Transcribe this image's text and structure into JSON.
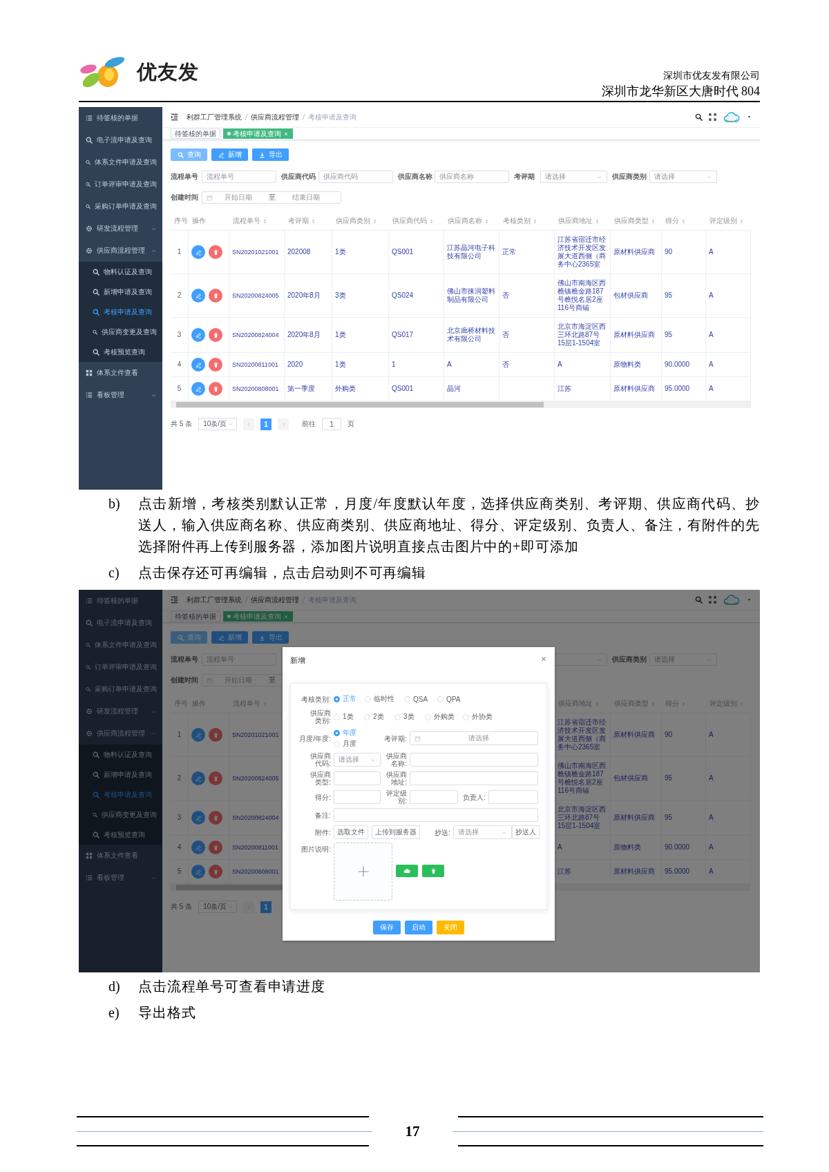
{
  "header": {
    "logo_text": "优友发",
    "company": "深圳市优友发有限公司",
    "address": "深圳市龙华新区大唐时代 804"
  },
  "content": [
    {
      "kind": "screenshot",
      "sidebar": [
        {
          "label": "待签核的单据",
          "selected": false
        },
        {
          "label": "电子流申请及查询",
          "selected": false
        },
        {
          "label": "体系文件申请及查询",
          "selected": false
        },
        {
          "label": "订单评审申请及查询",
          "selected": false
        },
        {
          "label": "采购订单申请及查询",
          "selected": false
        },
        {
          "label": "研发流程管理",
          "selected": false,
          "expanded": false
        },
        {
          "label": "供应商流程管理",
          "selected": false,
          "expanded": true,
          "children": [
            {
              "label": "物料认证及查询",
              "selected": false
            },
            {
              "label": "新增申请及查询",
              "selected": false
            },
            {
              "label": "考核申请及查询",
              "selected": true
            },
            {
              "label": "供应商变更及查询",
              "selected": false
            },
            {
              "label": "考核预览查询",
              "selected": false
            }
          ]
        },
        {
          "label": "体系文件查看",
          "selected": false
        },
        {
          "label": "看板管理",
          "selected": false,
          "expanded": false
        }
      ],
      "breadcrumb": [
        {
          "label": "利群工厂管理系统",
          "current": false
        },
        {
          "label": "供应商流程管理",
          "current": false
        },
        {
          "label": "考核申请及查询",
          "current": true
        }
      ],
      "tags": [
        {
          "label": "待签核的单据",
          "selected": false
        },
        {
          "label": "考核申请及查询",
          "selected": true
        }
      ],
      "toolbar": [
        {
          "label": "查询",
          "kind": "plain"
        },
        {
          "label": "新增",
          "kind": "primary"
        },
        {
          "label": "导出",
          "kind": "primary"
        }
      ],
      "filters": {
        "flow_no": {
          "kind": "input",
          "label": "流程单号",
          "placeholder": "流程单号"
        },
        "supplier_code": {
          "kind": "input",
          "label": "供应商代码",
          "placeholder": "供应商代码"
        },
        "supplier_name": {
          "kind": "input",
          "label": "供应商名称",
          "placeholder": "供应商名称"
        },
        "period": {
          "kind": "select",
          "label": "考评期",
          "placeholder": "请选择"
        },
        "supplier_category": {
          "kind": "select",
          "label": "供应商类别",
          "placeholder": "请选择"
        },
        "created": {
          "kind": "date_range",
          "label": "创建时间",
          "start_placeholder": "开始日期",
          "separator": "至",
          "end_placeholder": "结束日期"
        }
      },
      "table": {
        "columns": {
          "seq": {
            "label": "序号",
            "sortable": false
          },
          "op": {
            "label": "操作",
            "sortable": false
          },
          "flow_no": {
            "label": "流程单号",
            "sortable": true
          },
          "period": {
            "label": "考评期",
            "sortable": true
          },
          "supplier_category": {
            "label": "供应商类别",
            "sortable": true
          },
          "supplier_code": {
            "label": "供应商代码",
            "sortable": true
          },
          "supplier_name": {
            "label": "供应商名称",
            "sortable": true
          },
          "assess_type": {
            "label": "考核类别",
            "sortable": true
          },
          "supplier_address": {
            "label": "供应商地址",
            "sortable": true
          },
          "supplier_type": {
            "label": "供应商类型",
            "sortable": true
          },
          "score": {
            "label": "得分",
            "sortable": true
          },
          "grade": {
            "label": "评定级别",
            "sortable": true
          }
        },
        "rows": [
          {
            "seq": "1",
            "flow_no": "SN20201021001",
            "period": "202008",
            "supplier_category": "1类",
            "supplier_code": "QS001",
            "supplier_name": "江苏晶河电子科技有限公司",
            "assess_type": "正常",
            "supplier_address": "江苏省宿迁市经济技术开发区发展大道西侧（商务中心2365室",
            "supplier_type": "原材料供应商",
            "score": "90",
            "grade": "A"
          },
          {
            "seq": "2",
            "flow_no": "SN20200824005",
            "period": "2020年8月",
            "supplier_category": "3类",
            "supplier_code": "QS024",
            "supplier_name": "佛山市徕润塑料制品有限公司",
            "assess_type": "否",
            "supplier_address": "佛山市南海区西樵镇樵金路187号樵悦名居2座116号商铺",
            "supplier_type": "包材供应商",
            "score": "95",
            "grade": "A"
          },
          {
            "seq": "3",
            "flow_no": "SN20200824004",
            "period": "2020年8月",
            "supplier_category": "1类",
            "supplier_code": "QS017",
            "supplier_name": "北京廊桥材料技术有限公司",
            "assess_type": "否",
            "supplier_address": "北京市海淀区西三环北路87号15层1-1504室",
            "supplier_type": "原材料供应商",
            "score": "95",
            "grade": "A"
          },
          {
            "seq": "4",
            "flow_no": "SN20200811001",
            "period": "2020",
            "supplier_category": "1类",
            "supplier_code": "1",
            "supplier_name": "A",
            "assess_type": "否",
            "supplier_address": "A",
            "supplier_type": "原物料类",
            "score": "90.0000",
            "grade": "A"
          },
          {
            "seq": "5",
            "flow_no": "SN20200808001",
            "period": "第一季度",
            "supplier_category": "外购类",
            "supplier_code": "QS001",
            "supplier_name": "晶河",
            "supplier_address": "江苏",
            "supplier_type": "原材料供应商",
            "score": "95.0000",
            "grade": "A"
          }
        ]
      },
      "pager": {
        "total": "共 5 条",
        "page_size": "10条/页",
        "pages": [
          {
            "label": "1",
            "selected": true
          }
        ],
        "goto_label": "前往",
        "goto_value": "1",
        "page_suffix": "页"
      }
    },
    {
      "kind": "note",
      "marker": "b)",
      "text": "点击新增，考核类别默认正常，月度/年度默认年度，选择供应商类别、考评期、供应商代码、抄送人，输入供应商名称、供应商类别、供应商地址、得分、评定级别、负责人、备注，有附件的先选择附件再上传到服务器，添加图片说明直接点击图片中的+即可添加"
    },
    {
      "kind": "note",
      "marker": "c)",
      "text": "点击保存还可再编辑，点击启动则不可再编辑"
    },
    {
      "kind": "screenshot",
      "sidebar": [
        {
          "label": "待签核的单据",
          "selected": false
        },
        {
          "label": "电子流申请及查询",
          "selected": false
        },
        {
          "label": "体系文件申请及查询",
          "selected": false
        },
        {
          "label": "订单评审申请及查询",
          "selected": false
        },
        {
          "label": "采购订单申请及查询",
          "selected": false
        },
        {
          "label": "研发流程管理",
          "selected": false,
          "expanded": false
        },
        {
          "label": "供应商流程管理",
          "selected": false,
          "expanded": true,
          "children": [
            {
              "label": "物料认证及查询",
              "selected": false
            },
            {
              "label": "新增申请及查询",
              "selected": false
            },
            {
              "label": "考核申请及查询",
              "selected": true
            },
            {
              "label": "供应商变更及查询",
              "selected": false
            },
            {
              "label": "考核预览查询",
              "selected": false
            }
          ]
        },
        {
          "label": "体系文件查看",
          "selected": false
        },
        {
          "label": "看板管理",
          "selected": false,
          "expanded": false
        }
      ],
      "breadcrumb": [
        {
          "label": "利群工厂管理系统",
          "current": false
        },
        {
          "label": "供应商流程管理",
          "current": false
        },
        {
          "label": "考核申请及查询",
          "current": true
        }
      ],
      "tags": [
        {
          "label": "待签核的单据",
          "selected": false
        },
        {
          "label": "考核申请及查询",
          "selected": true
        }
      ],
      "toolbar": [
        {
          "label": "查询",
          "kind": "plain"
        },
        {
          "label": "新增",
          "kind": "primary"
        },
        {
          "label": "导出",
          "kind": "primary"
        }
      ],
      "filters": {
        "flow_no": {
          "kind": "input",
          "label": "流程单号",
          "placeholder": "流程单号"
        },
        "period": {
          "kind": "select"
        },
        "supplier_category": {
          "kind": "select",
          "label": "供应商类别",
          "placeholder": "请选择"
        },
        "created": {
          "kind": "date_range",
          "label": "创建时间",
          "start_placeholder": "开始日期",
          "separator": "至"
        }
      },
      "table": {
        "columns": {
          "seq": {
            "label": "序号",
            "sortable": false
          },
          "op": {
            "label": "操作",
            "sortable": false
          },
          "flow_no": {
            "label": "流程单号",
            "sortable": true
          },
          "supplier_address": {
            "label": "供应商地址",
            "sortable": true
          },
          "supplier_type": {
            "label": "供应商类型",
            "sortable": true
          },
          "score": {
            "label": "得分",
            "sortable": true
          },
          "grade": {
            "label": "评定级别",
            "sortable": true
          }
        },
        "rows": [
          {
            "seq": "1",
            "flow_no": "SN20201021001",
            "supplier_address": "江苏省宿迁市经济技术开发区发展大道西侧（商务中心2365室",
            "supplier_type": "原材料供应商",
            "score": "90",
            "grade": "A"
          },
          {
            "seq": "2",
            "flow_no": "SN20200824005",
            "supplier_address": "佛山市南海区西樵镇樵金路187号樵悦名居2座116号商铺",
            "supplier_type": "包材供应商",
            "score": "95",
            "grade": "A"
          },
          {
            "seq": "3",
            "flow_no": "SN20200824004",
            "supplier_address": "北京市海淀区西三环北路87号15层1-1504室",
            "supplier_type": "原材料供应商",
            "score": "95",
            "grade": "A"
          },
          {
            "seq": "4",
            "flow_no": "SN20200811001",
            "supplier_address": "A",
            "supplier_type": "原物料类",
            "score": "90.0000",
            "grade": "A"
          },
          {
            "seq": "5",
            "flow_no": "SN20200808001",
            "supplier_address": "江苏",
            "supplier_type": "原材料供应商",
            "score": "95.0000",
            "grade": "A"
          }
        ]
      },
      "pager": {
        "total": "共 5 条",
        "page_size": "10条/页",
        "pages": [
          {
            "label": "1",
            "selected": true
          }
        ]
      },
      "modal": {
        "title": "新增",
        "form": {
          "assess_type": {
            "label": "考核类别:",
            "options": [
              {
                "label": "正常",
                "selected": true
              },
              {
                "label": "临时性",
                "selected": false
              },
              {
                "label": "QSA",
                "selected": false
              },
              {
                "label": "QPA",
                "selected": false
              }
            ]
          },
          "supplier_category": {
            "label": "供应商类别:",
            "options": [
              {
                "label": "1类",
                "selected": false
              },
              {
                "label": "2类",
                "selected": false
              },
              {
                "label": "3类",
                "selected": false
              },
              {
                "label": "外购类",
                "selected": false
              },
              {
                "label": "外协类",
                "selected": false
              }
            ]
          },
          "period_type": {
            "label": "月度/年度:",
            "options": [
              {
                "label": "年度",
                "selected": true
              },
              {
                "label": "月度",
                "selected": false
              }
            ]
          },
          "period": {
            "label": "考评期:",
            "placeholder": "请选择"
          },
          "supplier_code": {
            "label": "供应商代码:",
            "placeholder": "请选择"
          },
          "supplier_name": {
            "label": "供应商名称:"
          },
          "supplier_type": {
            "label": "供应商类型:"
          },
          "supplier_address": {
            "label": "供应商地址:"
          },
          "score": {
            "label": "得分:"
          },
          "grade": {
            "label": "评定级别:"
          },
          "owner": {
            "label": "负责人:"
          },
          "remark": {
            "label": "备注:"
          },
          "attachment": {
            "label": "附件:",
            "buttons": [
              "选取文件",
              "上传到服务器"
            ]
          },
          "cc": {
            "label": "抄送:",
            "placeholder": "请选择",
            "button": "抄送人"
          },
          "image": {
            "label": "图片说明:"
          }
        },
        "buttons": [
          {
            "label": "保存",
            "kind": "primary"
          },
          {
            "label": "启动",
            "kind": "primary"
          },
          {
            "label": "关闭",
            "kind": "warning"
          }
        ]
      }
    },
    {
      "kind": "note",
      "marker": "d)",
      "text": "点击流程单号可查看申请进度"
    },
    {
      "kind": "note",
      "marker": "e)",
      "text": "导出格式"
    }
  ],
  "footer": {
    "page_number": "17"
  }
}
